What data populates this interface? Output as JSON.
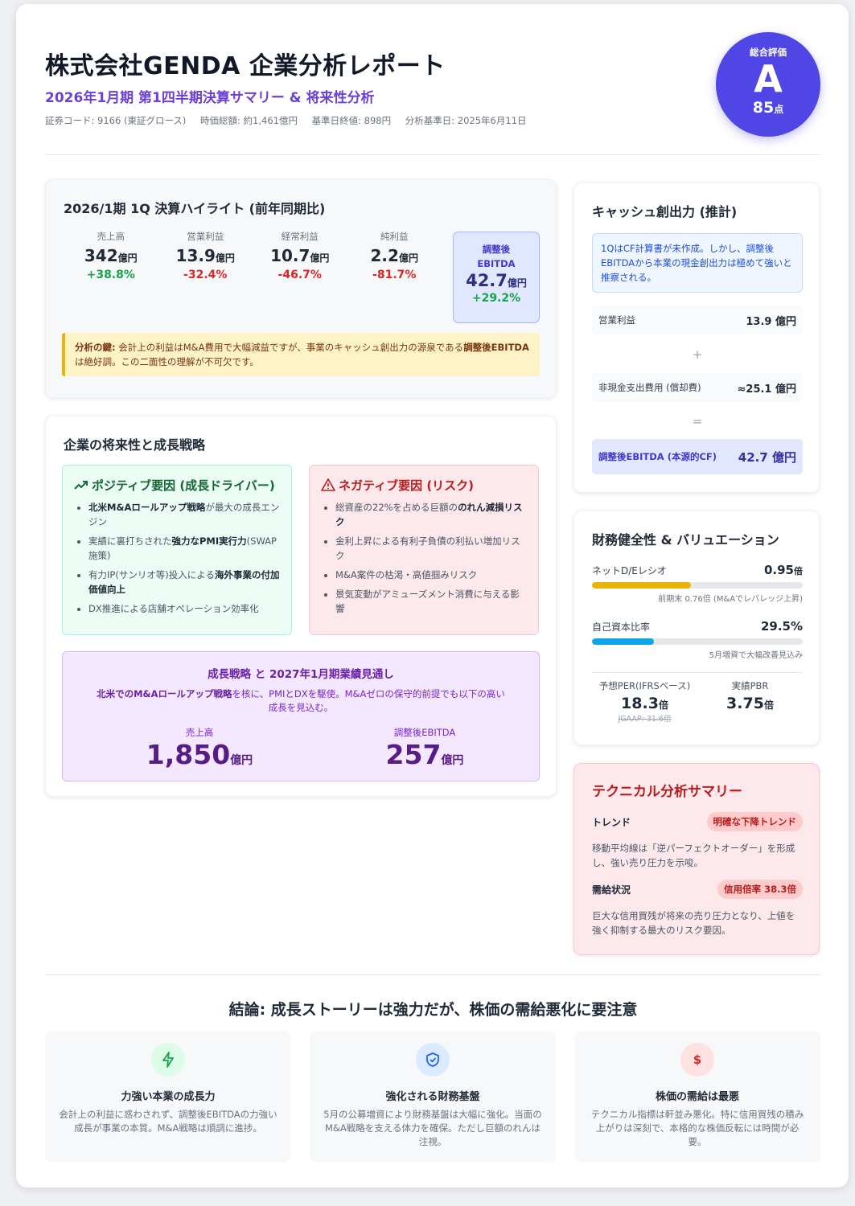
{
  "header": {
    "title": "株式会社GENDA 企業分析レポート",
    "subtitle": "2026年1月期 第1四半期決算サマリー & 将来性分析",
    "meta": [
      "証券コード: 9166 (東証グロース)",
      "時価総額: 約1,461億円",
      "基準日終値: 898円",
      "分析基準日: 2025年6月11日"
    ]
  },
  "score": {
    "label": "総合評価",
    "grade": "A",
    "points": "85",
    "points_unit": "点"
  },
  "highlights": {
    "title": "2026/1期 1Q 決算ハイライト (前年同期比)",
    "unit": "億円",
    "metrics": [
      {
        "label": "売上高",
        "value": "342",
        "change": "+38.8%",
        "direction": "up"
      },
      {
        "label": "営業利益",
        "value": "13.9",
        "change": "-32.4%",
        "direction": "down"
      },
      {
        "label": "経常利益",
        "value": "10.7",
        "change": "-46.7%",
        "direction": "down"
      },
      {
        "label": "純利益",
        "value": "2.2",
        "change": "-81.7%",
        "direction": "down"
      }
    ],
    "ebitda": {
      "label1": "調整後",
      "label2": "EBITDA",
      "value": "42.7",
      "change": "+29.2%"
    },
    "key_label": "分析の鍵:",
    "key_text1": " 会計上の利益はM&A費用で大幅減益ですが、事業のキャッシュ創出力の源泉である",
    "key_bold": "調整後EBITDA",
    "key_text2": "は絶好調。この二面性の理解が不可欠です。"
  },
  "future": {
    "title": "企業の将来性と成長戦略",
    "positive": {
      "title": "ポジティブ要因 (成長ドライバー)",
      "items": [
        {
          "bold": "北米M&Aロールアップ戦略",
          "pre": "",
          "post": "が最大の成長エンジン"
        },
        {
          "pre": "実績に裏打ちされた",
          "bold": "強力なPMI実行力",
          "post": "(SWAP施策)"
        },
        {
          "pre": "有力IP(サンリオ等)投入による",
          "bold": "海外事業の付加価値向上",
          "post": ""
        },
        {
          "pre": "DX推進による店舗オペレーション効率化",
          "bold": "",
          "post": ""
        }
      ]
    },
    "negative": {
      "title": "ネガティブ要因 (リスク)",
      "items": [
        {
          "pre": "総資産の22%を占める巨額の",
          "bold": "のれん減損リスク",
          "post": ""
        },
        {
          "pre": "金利上昇による有利子負債の利払い増加リスク",
          "bold": "",
          "post": ""
        },
        {
          "pre": "M&A案件の枯渇・高値掴みリスク",
          "bold": "",
          "post": ""
        },
        {
          "pre": "景気変動がアミューズメント消費に与える影響",
          "bold": "",
          "post": ""
        }
      ]
    },
    "strategy": {
      "title": "成長戦略 と 2027年1月期業績見通し",
      "desc_bold": "北米でのM&Aロールアップ戦略",
      "desc": "を核に、PMIとDXを駆使。M&Aゼロの保守的前提でも以下の高い成長を見込む。",
      "sales_label": "売上高",
      "sales_value": "1,850",
      "ebitda_label": "調整後EBITDA",
      "ebitda_value": "257",
      "unit": "億円"
    }
  },
  "cash": {
    "title": "キャッシュ創出力 (推計)",
    "note": "1QはCF計算書が未作成。しかし、調整後EBITDAから本業の現金創出力は極めて強いと推察される。",
    "row1_label": "営業利益",
    "row1_value": "13.9 億円",
    "plus": "+",
    "row2_label": "非現金支出費用 (償却費)",
    "row2_value": "≈25.1 億円",
    "equals": "=",
    "row3_label": "調整後EBITDA (本源的CF)",
    "row3_value": "42.7 億円"
  },
  "finance": {
    "title": "財務健全性 & バリュエーション",
    "de": {
      "label": "ネットD/Eレシオ",
      "value": "0.95",
      "unit": "倍",
      "fill_fraction": 0.47,
      "note": "前期末 0.76倍 (M&Aでレバレッジ上昇)",
      "color": "#eab308"
    },
    "equity": {
      "label": "自己資本比率",
      "value": "29.5%",
      "fill_fraction": 0.295,
      "note": "5月増資で大幅改善見込み",
      "color": "#0ea5e9"
    },
    "per": {
      "label": "予想PER(IFRSベース)",
      "value": "18.3",
      "unit": "倍",
      "strike": "JGAAP: 31.6倍"
    },
    "pbr": {
      "label": "実績PBR",
      "value": "3.75",
      "unit": "倍"
    }
  },
  "technical": {
    "title": "テクニカル分析サマリー",
    "trend_label": "トレンド",
    "trend_tag": "明確な下降トレンド",
    "trend_desc": "移動平均線は「逆パーフェクトオーダー」を形成し、強い売り圧力を示唆。",
    "supply_label": "需給状況",
    "supply_tag": "信用倍率 38.3倍",
    "supply_desc": "巨大な信用買残が将来の売り圧力となり、上値を強く抑制する最大のリスク要因。"
  },
  "conclusion": {
    "title": "結論: 成長ストーリーは強力だが、株価の需給悪化に要注意",
    "cards": [
      {
        "icon": "lightning-icon",
        "title": "力強い本業の成長力",
        "desc": "会計上の利益に惑わされず、調整後EBITDAの力強い成長が事業の本質。M&A戦略は順調に進捗。"
      },
      {
        "icon": "shield-check-icon",
        "title": "強化される財務基盤",
        "desc": "5月の公募増資により財務基盤は大幅に強化。当面のM&A戦略を支える体力を確保。ただし巨額のれんは注視。"
      },
      {
        "icon": "dollar-icon",
        "title": "株価の需給は最悪",
        "desc": "テクニカル指標は軒並み悪化。特に信用買残の積み上がりは深刻で、本格的な株価反転には時間が必要。"
      }
    ]
  }
}
